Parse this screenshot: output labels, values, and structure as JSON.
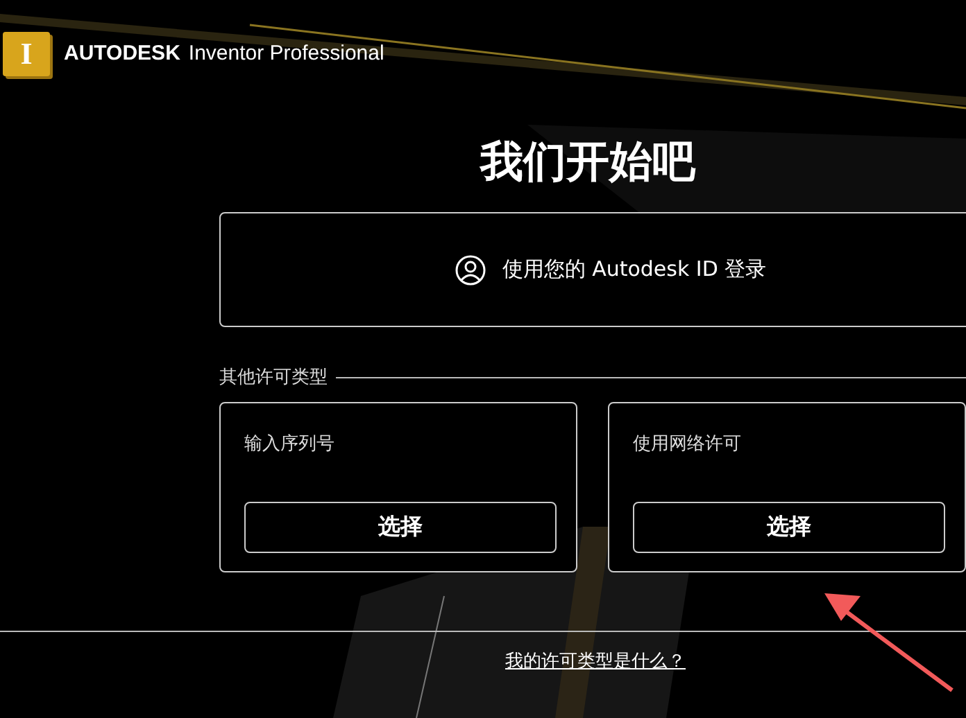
{
  "header": {
    "logo_letter": "I",
    "brand": "AUTODESK",
    "product": "Inventor Professional"
  },
  "title": "我们开始吧",
  "sign_in": {
    "label": "使用您的 Autodesk ID 登录"
  },
  "other_types": {
    "label": "其他许可类型",
    "options": [
      {
        "label": "输入序列号",
        "button": "选择"
      },
      {
        "label": "使用网络许可",
        "button": "选择"
      }
    ]
  },
  "help_link": "我的许可类型是什么？"
}
